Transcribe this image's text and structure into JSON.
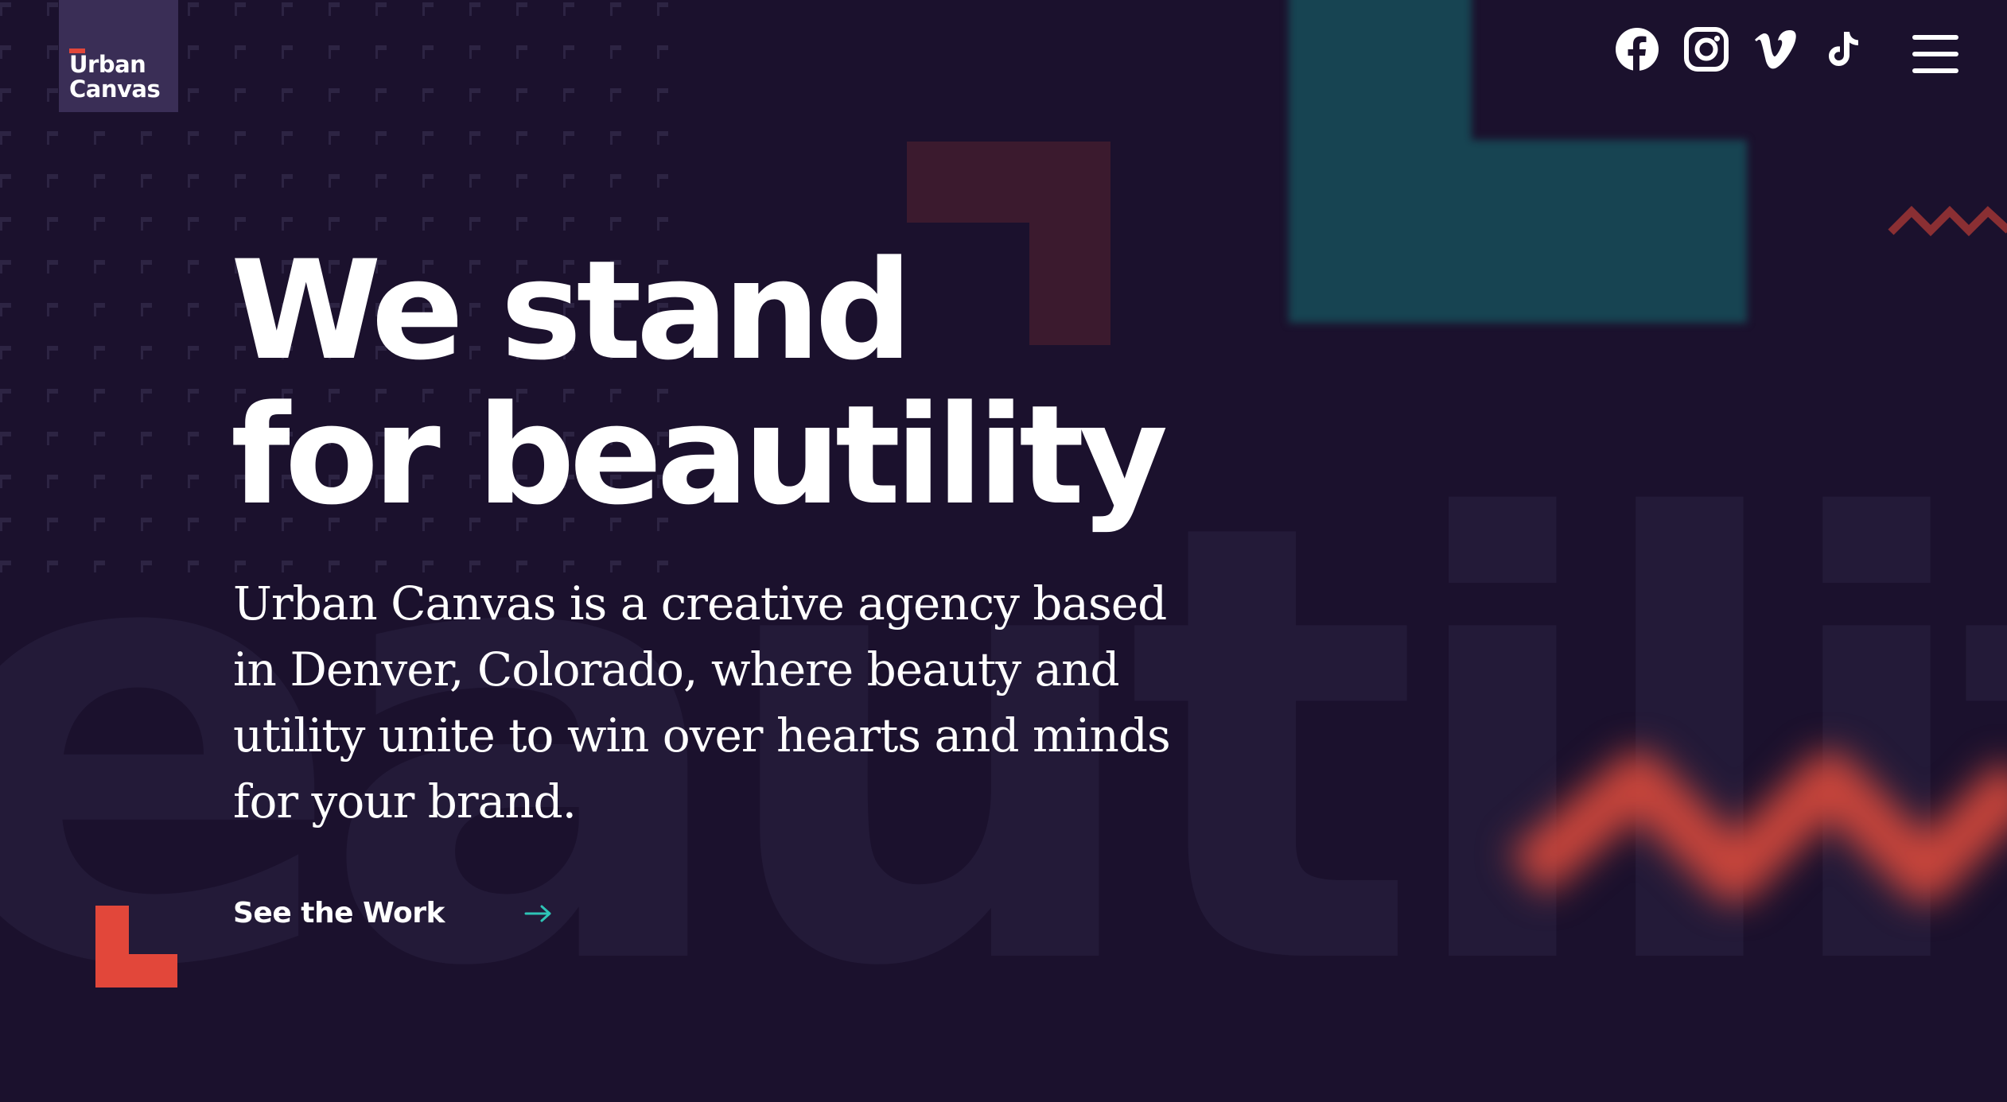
{
  "brand": {
    "logo_line1": "Urban",
    "logo_line2": "Canvas",
    "accent": "#e2473a",
    "teal": "#174452",
    "maroon": "#3b1a2e",
    "background": "#1b112d"
  },
  "header": {
    "social": [
      {
        "name": "facebook-icon"
      },
      {
        "name": "instagram-icon"
      },
      {
        "name": "vimeo-icon"
      },
      {
        "name": "tiktok-icon"
      }
    ],
    "menu_icon": "hamburger-menu-icon"
  },
  "hero": {
    "headline_line1": "We stand",
    "headline_line2": "for beautility",
    "lede": "Urban Canvas is a creative agency based in Denver, Colorado, where beauty and utility unite to win over hearts and minds for your brand.",
    "cta_label": "See the Work",
    "cta_icon": "arrow-right-icon",
    "cta_arrow_color": "#2ec4b6",
    "background_word": "eautility"
  }
}
